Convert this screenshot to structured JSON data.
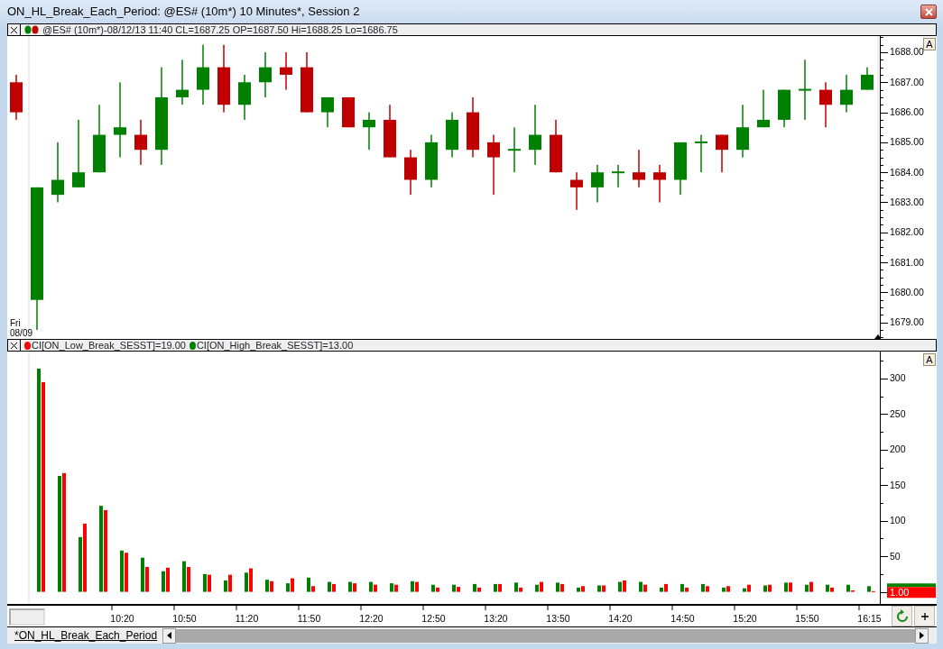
{
  "window": {
    "title": "ON_HL_Break_Each_Period: @ES# (10m*) 10 Minutes*, Session 2"
  },
  "price_pane": {
    "header": "@ES# (10m*)-08/12/13 11:40 CL=1687.25 OP=1687.50 Hi=1688.25 Lo=1686.75",
    "autoscale": "A",
    "date_label": [
      "Fri",
      "08/09"
    ],
    "chart_data": {
      "type": "candlestick",
      "ylim": [
        1678.45,
        1688.54
      ],
      "categories": [
        null,
        null,
        null,
        null,
        null,
        null,
        null,
        null,
        null,
        null,
        null,
        null,
        null,
        null,
        null,
        null,
        null,
        null,
        null,
        null,
        null,
        null,
        null,
        null,
        null,
        null,
        null,
        null,
        null,
        null,
        null,
        null,
        null,
        null,
        null,
        null,
        null,
        null,
        null,
        null,
        null,
        null
      ],
      "yticks": [
        {
          "value": 1688,
          "label": "1688.00"
        },
        {
          "value": 1687,
          "label": "1687.00"
        },
        {
          "value": 1686,
          "label": "1686.00"
        },
        {
          "value": 1685,
          "label": "1685.00"
        },
        {
          "value": 1684,
          "label": "1684.00"
        },
        {
          "value": 1683,
          "label": "1683.00"
        },
        {
          "value": 1682,
          "label": "1682.00"
        },
        {
          "value": 1681,
          "label": "1681.00"
        },
        {
          "value": 1680,
          "label": "1680.00"
        },
        {
          "value": 1679,
          "label": "1679.00"
        }
      ],
      "ohlc": [
        [
          1687,
          1687.25,
          1685.75,
          1686
        ],
        [
          1679.75,
          1683.5,
          1678.75,
          1683.5
        ],
        [
          1683.25,
          1685,
          1683,
          1683.75
        ],
        [
          1683.5,
          1685.75,
          1683.5,
          1684
        ],
        [
          1684,
          1686.25,
          1684,
          1685.25
        ],
        [
          1685.25,
          1687,
          1684.5,
          1685.5
        ],
        [
          1685.25,
          1685.75,
          1684.25,
          1684.75
        ],
        [
          1684.75,
          1687.5,
          1684.25,
          1686.5
        ],
        [
          1686.5,
          1687.75,
          1686.25,
          1686.75
        ],
        [
          1686.75,
          1688.25,
          1686.25,
          1687.5
        ],
        [
          1687.5,
          1688.25,
          1686,
          1686.25
        ],
        [
          1686.25,
          1687.25,
          1685.75,
          1687
        ],
        [
          1687,
          1688,
          1686.5,
          1687.5
        ],
        [
          1687.5,
          1688,
          1686.75,
          1687.25
        ],
        [
          1687.5,
          1688,
          1686,
          1686
        ],
        [
          1686,
          1686.5,
          1685.5,
          1686.5
        ],
        [
          1686.5,
          1686.5,
          1685.5,
          1685.5
        ],
        [
          1685.5,
          1686,
          1684.75,
          1685.75
        ],
        [
          1685.75,
          1686.25,
          1684.5,
          1684.5
        ],
        [
          1684.5,
          1684.75,
          1683.25,
          1683.75
        ],
        [
          1683.75,
          1685.25,
          1683.5,
          1685
        ],
        [
          1684.75,
          1686,
          1684.5,
          1685.75
        ],
        [
          1686,
          1686.5,
          1684.5,
          1684.75
        ],
        [
          1685,
          1685.25,
          1683.25,
          1684.5
        ],
        [
          1684.75,
          1685.5,
          1684,
          1684.75
        ],
        [
          1684.75,
          1686.25,
          1684.25,
          1685.25
        ],
        [
          1685.25,
          1685.75,
          1684,
          1684
        ],
        [
          1683.75,
          1684,
          1682.75,
          1683.5
        ],
        [
          1683.5,
          1684.25,
          1683,
          1684
        ],
        [
          1684,
          1684.25,
          1683.5,
          1684
        ],
        [
          1684,
          1684.75,
          1683.5,
          1683.75
        ],
        [
          1684,
          1684.25,
          1683,
          1683.75
        ],
        [
          1683.75,
          1685,
          1683.25,
          1685
        ],
        [
          1685,
          1685.25,
          1684,
          1685
        ],
        [
          1685.25,
          1685.25,
          1684,
          1684.75
        ],
        [
          1684.75,
          1686.25,
          1684.5,
          1685.5
        ],
        [
          1685.5,
          1686.75,
          1685.5,
          1685.75
        ],
        [
          1685.75,
          1686.75,
          1685.5,
          1686.75
        ],
        [
          1686.75,
          1687.75,
          1685.75,
          1686.75
        ],
        [
          1686.75,
          1687,
          1685.5,
          1686.25
        ],
        [
          1686.25,
          1687.25,
          1686,
          1686.75
        ],
        [
          1686.75,
          1687.5,
          1686.75,
          1687.25
        ]
      ]
    }
  },
  "indicator_pane": {
    "legend_readings": [
      "=19.00",
      "=13.00"
    ],
    "autoscale": "A",
    "value_label": "1.00",
    "chart_data": {
      "type": "bar",
      "ylim": [
        -17,
        338
      ],
      "categories": [
        null,
        null,
        null,
        null,
        null,
        "10:20",
        null,
        null,
        "10:50",
        null,
        null,
        "11:20",
        null,
        null,
        "11:50",
        null,
        null,
        "12:20",
        null,
        null,
        "12:50",
        null,
        null,
        "13:20",
        null,
        null,
        "13:50",
        null,
        null,
        "14:20",
        null,
        null,
        "14:50",
        null,
        null,
        "15:20",
        null,
        null,
        "15:50",
        null,
        null,
        "16:15"
      ],
      "yticks": [
        {
          "value": 300,
          "label": "300"
        },
        {
          "value": 250,
          "label": "250"
        },
        {
          "value": 200,
          "label": "200"
        },
        {
          "value": 150,
          "label": "150"
        },
        {
          "value": 100,
          "label": "100"
        },
        {
          "value": 50,
          "label": "50"
        }
      ],
      "series": [
        {
          "name": "CI[ON_Low_Break_SESST]",
          "color": "#ff0000",
          "values": [
            null,
            295,
            167,
            96,
            115,
            55,
            35,
            34,
            35,
            24,
            24,
            33,
            15,
            19,
            8,
            11,
            12,
            10,
            10,
            14,
            6,
            7,
            6,
            11,
            6,
            14,
            11,
            8,
            9,
            16,
            10,
            11,
            6,
            8,
            8,
            10,
            10,
            13,
            14,
            6,
            2,
            1
          ]
        },
        {
          "name": "CI[ON_High_Break_SESST]",
          "color": "#008000",
          "values": [
            null,
            314,
            163,
            77,
            121,
            58,
            48,
            29,
            43,
            25,
            16,
            27,
            17,
            12,
            20,
            14,
            14,
            14,
            12,
            15,
            10,
            10,
            11,
            11,
            13,
            10,
            13,
            6,
            9,
            14,
            14,
            6,
            11,
            11,
            6,
            5,
            9,
            13,
            10,
            10,
            10,
            8
          ]
        }
      ]
    }
  },
  "tab": {
    "label": "*ON_HL_Break_Each_Period"
  }
}
